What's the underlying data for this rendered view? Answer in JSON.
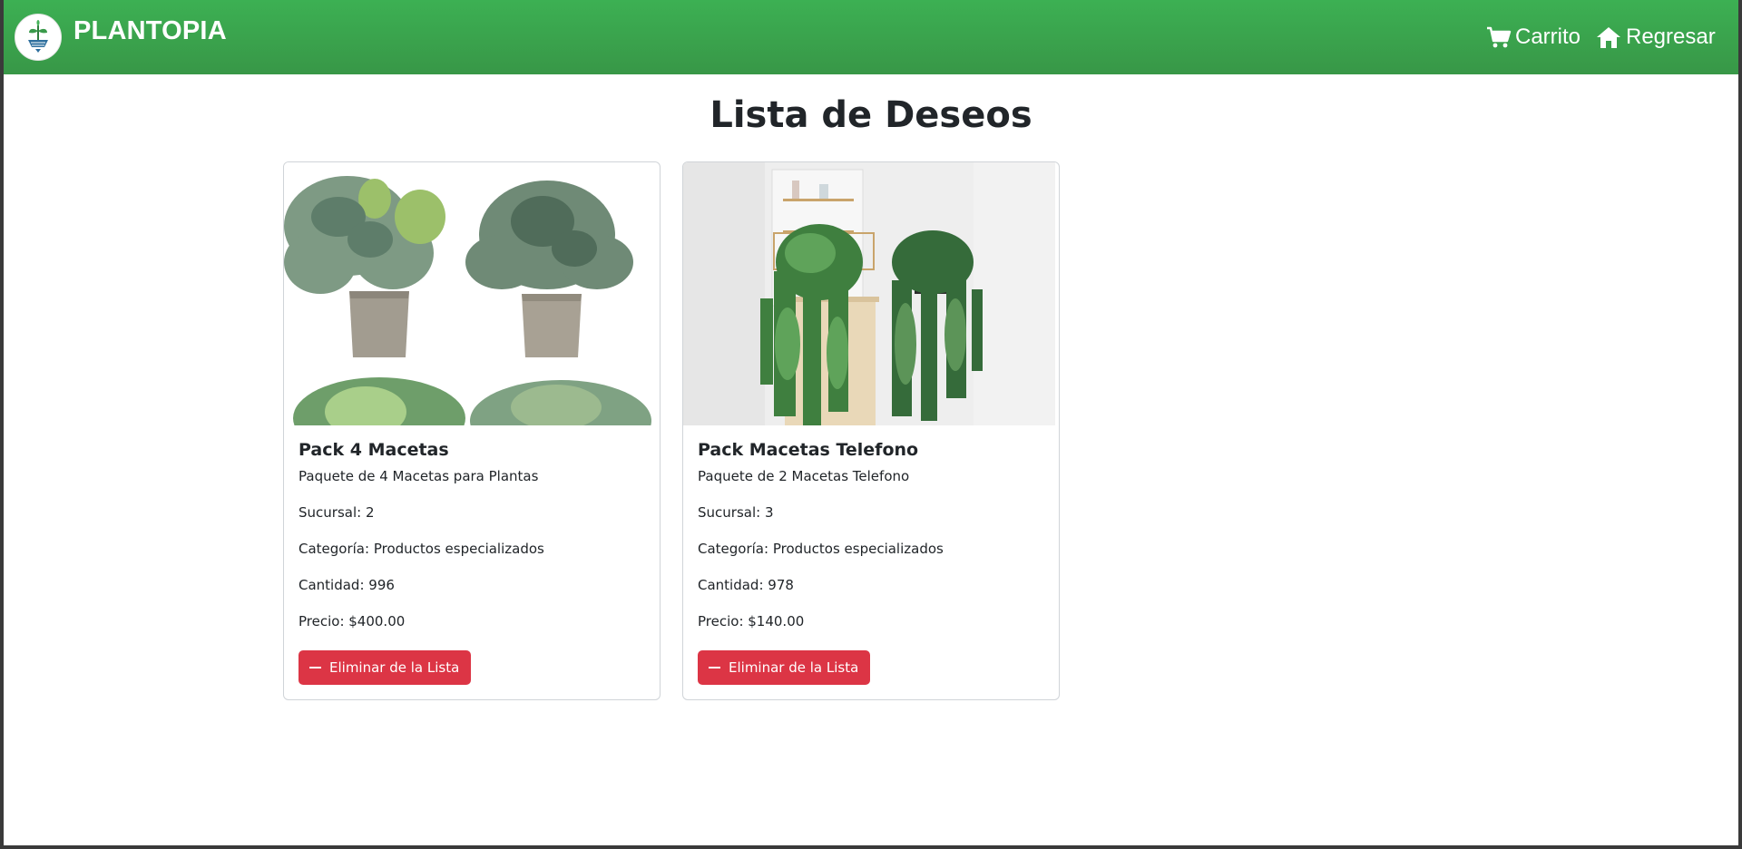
{
  "navbar": {
    "brand": "PLANTOPIA",
    "cart_label": "Carrito",
    "back_label": "Regresar",
    "bg_color": "#3cb053"
  },
  "page": {
    "title": "Lista de Deseos"
  },
  "wishlist": [
    {
      "name": "Pack 4 Macetas",
      "description": "Paquete de 4 Macetas para Plantas",
      "branch": "Sucursal: 2",
      "category": "Categoría: Productos especializados",
      "quantity": "Cantidad: 996",
      "price": "Precio: $400.00",
      "remove_label": "Eliminar de la Lista"
    },
    {
      "name": "Pack Macetas Telefono",
      "description": "Paquete de 2 Macetas Telefono",
      "branch": "Sucursal: 3",
      "category": "Categoría: Productos especializados",
      "quantity": "Cantidad: 978",
      "price": "Precio: $140.00",
      "remove_label": "Eliminar de la Lista"
    }
  ],
  "colors": {
    "danger": "#dc3545",
    "nav_green": "#3cb053"
  }
}
